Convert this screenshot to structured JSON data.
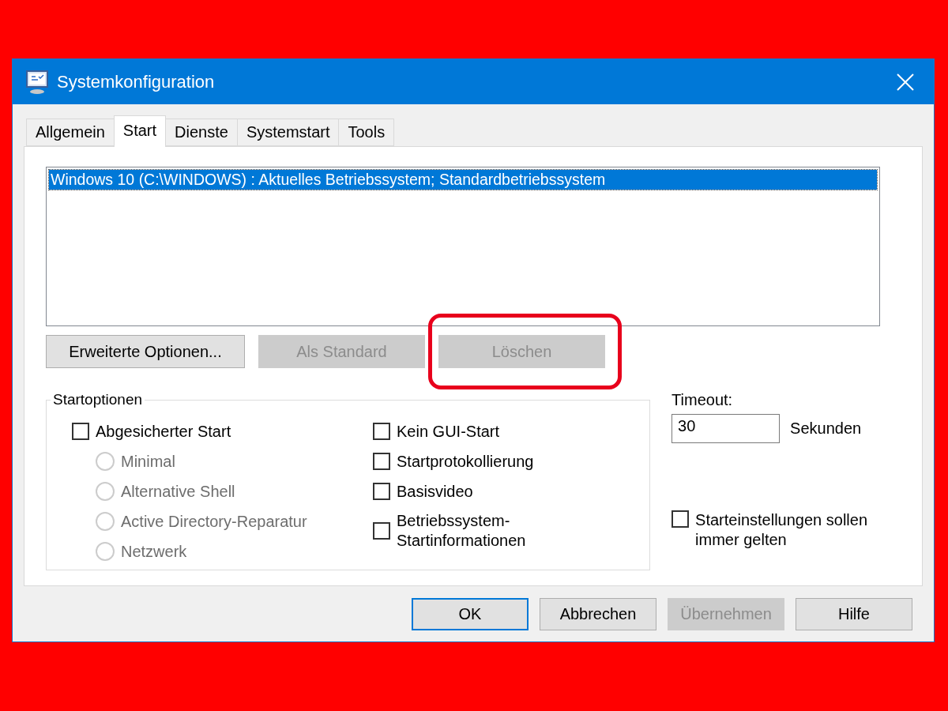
{
  "window": {
    "title": "Systemkonfiguration"
  },
  "tabs": [
    {
      "label": "Allgemein",
      "selected": false
    },
    {
      "label": "Start",
      "selected": true
    },
    {
      "label": "Dienste",
      "selected": false
    },
    {
      "label": "Systemstart",
      "selected": false
    },
    {
      "label": "Tools",
      "selected": false
    }
  ],
  "boot_list": {
    "entries": [
      {
        "text": "Windows 10 (C:\\WINDOWS) : Aktuelles Betriebssystem; Standardbetriebssystem",
        "selected": true
      }
    ]
  },
  "list_buttons": [
    {
      "label": "Erweiterte Optionen...",
      "disabled": false,
      "highlighted": false
    },
    {
      "label": "Als Standard",
      "disabled": true,
      "highlighted": false
    },
    {
      "label": "Löschen",
      "disabled": true,
      "highlighted": true
    }
  ],
  "startoptions": {
    "title": "Startoptionen",
    "left": [
      {
        "kind": "checkbox",
        "label": "Abgesicherter Start",
        "checked": false,
        "disabled": false
      },
      {
        "kind": "radio",
        "label": "Minimal",
        "selected": false,
        "disabled": true
      },
      {
        "kind": "radio",
        "label": "Alternative Shell",
        "selected": false,
        "disabled": true
      },
      {
        "kind": "radio",
        "label": "Active Directory-Reparatur",
        "selected": false,
        "disabled": true
      },
      {
        "kind": "radio",
        "label": "Netzwerk",
        "selected": false,
        "disabled": true
      }
    ],
    "right": [
      {
        "kind": "checkbox",
        "label": "Kein GUI-Start",
        "checked": false,
        "disabled": false
      },
      {
        "kind": "checkbox",
        "label": "Startprotokollierung",
        "checked": false,
        "disabled": false
      },
      {
        "kind": "checkbox",
        "label": "Basisvideo",
        "checked": false,
        "disabled": false
      },
      {
        "kind": "checkbox",
        "label": "Betriebssystem-Startinformationen",
        "checked": false,
        "disabled": false
      }
    ]
  },
  "timeout": {
    "label": "Timeout:",
    "value": "30",
    "unit": "Sekunden"
  },
  "persistent": {
    "label": "Starteinstellungen sollen immer gelten",
    "checked": false
  },
  "dialog_buttons": [
    {
      "label": "OK",
      "disabled": false,
      "default": true
    },
    {
      "label": "Abbrechen",
      "disabled": false,
      "default": false
    },
    {
      "label": "Übernehmen",
      "disabled": true,
      "default": false
    },
    {
      "label": "Hilfe",
      "disabled": false,
      "default": false
    }
  ]
}
